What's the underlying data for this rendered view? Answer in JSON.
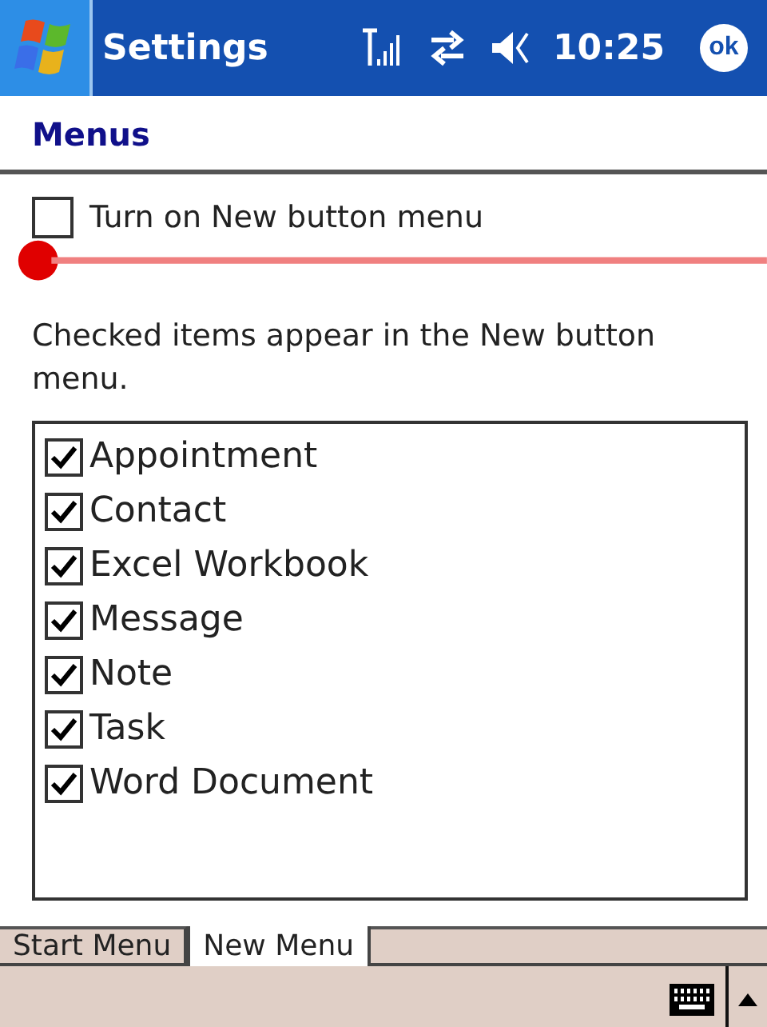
{
  "title_bar": {
    "title": "Settings",
    "time": "10:25",
    "ok": "ok"
  },
  "header": "Menus",
  "toggle": {
    "label": "Turn on New button menu",
    "checked": false
  },
  "description": "Checked items appear in the New button menu.",
  "items": [
    {
      "label": "Appointment",
      "checked": true
    },
    {
      "label": "Contact",
      "checked": true
    },
    {
      "label": "Excel Workbook",
      "checked": true
    },
    {
      "label": "Message",
      "checked": true
    },
    {
      "label": "Note",
      "checked": true
    },
    {
      "label": "Task",
      "checked": true
    },
    {
      "label": "Word Document",
      "checked": true
    }
  ],
  "tabs": [
    {
      "label": "Start Menu",
      "selected": false
    },
    {
      "label": "New Menu",
      "selected": true
    }
  ]
}
